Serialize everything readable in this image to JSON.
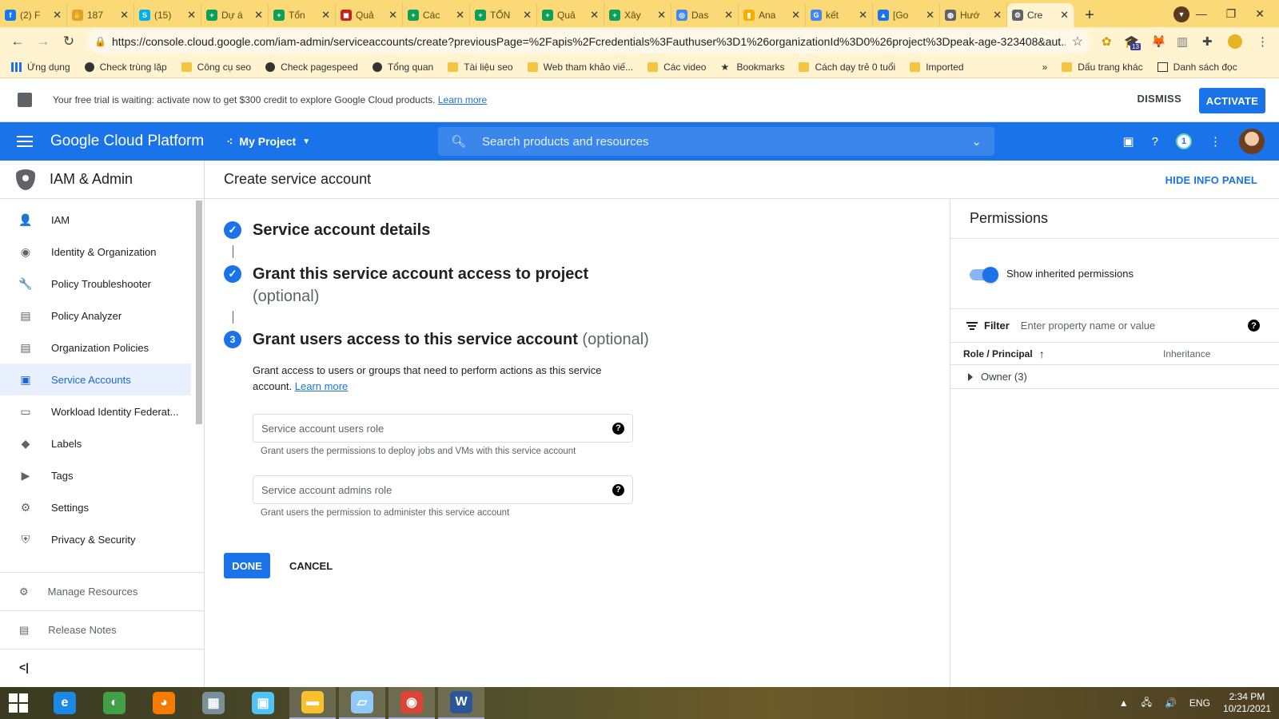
{
  "colors": {
    "accent": "#1a73e8",
    "browser_frame": "#fbd976",
    "active_nav_bg": "#e8f0fe"
  },
  "browser": {
    "tabs": [
      {
        "title": "(2) F",
        "icon": "facebook-icon",
        "color": "#1877f2",
        "glyph": "f"
      },
      {
        "title": "187",
        "icon": "hand-icon",
        "color": "#e0a030",
        "glyph": "✋"
      },
      {
        "title": "(15)",
        "icon": "skype-icon",
        "color": "#00aff0",
        "glyph": "S"
      },
      {
        "title": "Dự á",
        "icon": "sheets-icon",
        "color": "#0f9d58",
        "glyph": "+"
      },
      {
        "title": "Tổn",
        "icon": "sheets-icon",
        "color": "#0f9d58",
        "glyph": "+"
      },
      {
        "title": "Quả",
        "icon": "slides-icon",
        "color": "#c5221f",
        "glyph": "◼"
      },
      {
        "title": "Các",
        "icon": "sheets-icon",
        "color": "#0f9d58",
        "glyph": "+"
      },
      {
        "title": "TỔN",
        "icon": "sheets-icon",
        "color": "#0f9d58",
        "glyph": "+"
      },
      {
        "title": "Quả",
        "icon": "sheets-icon",
        "color": "#0f9d58",
        "glyph": "+"
      },
      {
        "title": "Xây",
        "icon": "sheets-icon",
        "color": "#0f9d58",
        "glyph": "+"
      },
      {
        "title": "Das",
        "icon": "datastudio-icon",
        "color": "#4285f4",
        "glyph": "◎"
      },
      {
        "title": "Ana",
        "icon": "analytics-icon",
        "color": "#f9ab00",
        "glyph": "▮"
      },
      {
        "title": "kết",
        "icon": "google-icon",
        "color": "#4285f4",
        "glyph": "G"
      },
      {
        "title": "[Go",
        "icon": "drive-icon",
        "color": "#1a73e8",
        "glyph": "▲"
      },
      {
        "title": "Hướ",
        "icon": "globe-icon",
        "color": "#5f6368",
        "glyph": "◍"
      },
      {
        "title": "Cre",
        "icon": "gcp-settings-icon",
        "color": "#5f6368",
        "glyph": "⚙"
      }
    ],
    "url": "https://console.cloud.google.com/iam-admin/serviceaccounts/create?previousPage=%2Fapis%2Fcredentials%3Fauthuser%3D1%26organizationId%3D0%26project%3Dpeak-age-323408&aut...",
    "bookmarks": [
      {
        "label": "Ứng dụng",
        "icon": "apps-grid-icon"
      },
      {
        "label": "Check trùng lặp",
        "icon": "globe-icon"
      },
      {
        "label": "Công cụ seo",
        "icon": "folder-icon"
      },
      {
        "label": "Check pagespeed",
        "icon": "globe-icon"
      },
      {
        "label": "Tổng quan",
        "icon": "filter-icon"
      },
      {
        "label": "Tài liệu seo",
        "icon": "folder-icon"
      },
      {
        "label": "Web tham khảo viế...",
        "icon": "folder-icon"
      },
      {
        "label": "Các video",
        "icon": "folder-icon"
      },
      {
        "label": "Bookmarks",
        "icon": "star-icon"
      },
      {
        "label": "Cách dạy trẻ 0 tuổi",
        "icon": "folder-icon"
      },
      {
        "label": "Imported",
        "icon": "folder-icon"
      }
    ],
    "bookmarks_more": "»",
    "other_bookmarks": "Dấu trang khác",
    "reading_list": "Danh sách đọc",
    "extension_badge": "13"
  },
  "trial": {
    "message": "Your free trial is waiting: activate now to get $300 credit to explore Google Cloud products.",
    "learn_more": "Learn more",
    "dismiss": "DISMISS",
    "activate": "ACTIVATE"
  },
  "header": {
    "brand": "Google Cloud Platform",
    "project": "My Project",
    "search_placeholder": "Search products and resources",
    "notification_count": "1"
  },
  "sidebar": {
    "title": "IAM & Admin",
    "items": [
      {
        "label": "IAM",
        "icon": "add-person-icon",
        "glyph": "👤"
      },
      {
        "label": "Identity & Organization",
        "icon": "account-circle-icon",
        "glyph": "◉"
      },
      {
        "label": "Policy Troubleshooter",
        "icon": "wrench-icon",
        "glyph": "🔧"
      },
      {
        "label": "Policy Analyzer",
        "icon": "document-search-icon",
        "glyph": "▤"
      },
      {
        "label": "Organization Policies",
        "icon": "list-document-icon",
        "glyph": "▤"
      },
      {
        "label": "Service Accounts",
        "icon": "service-account-icon",
        "glyph": "▣"
      },
      {
        "label": "Workload Identity Federat...",
        "icon": "id-card-icon",
        "glyph": "▭"
      },
      {
        "label": "Labels",
        "icon": "label-icon",
        "glyph": "◆"
      },
      {
        "label": "Tags",
        "icon": "tag-icon",
        "glyph": "▶"
      },
      {
        "label": "Settings",
        "icon": "gear-icon",
        "glyph": "⚙"
      },
      {
        "label": "Privacy & Security",
        "icon": "shield-icon",
        "glyph": "⛨"
      }
    ],
    "bottom": [
      {
        "label": "Manage Resources",
        "icon": "manage-resources-icon",
        "glyph": "⚙"
      },
      {
        "label": "Release Notes",
        "icon": "release-notes-icon",
        "glyph": "▤"
      }
    ],
    "collapse": "<|"
  },
  "main": {
    "title": "Create service account",
    "hide_info_panel": "HIDE INFO PANEL",
    "step1": {
      "title": "Service account details"
    },
    "step2": {
      "title": "Grant this service account access to project",
      "optional": "(optional)"
    },
    "step3": {
      "number": "3",
      "title": "Grant users access to this service account",
      "optional": "(optional)",
      "description": "Grant access to users or groups that need to perform actions as this service account.",
      "learn_more": "Learn more"
    },
    "users_role": {
      "placeholder": "Service account users role",
      "hint": "Grant users the permissions to deploy jobs and VMs with this service account"
    },
    "admins_role": {
      "placeholder": "Service account admins role",
      "hint": "Grant users the permission to administer this service account"
    },
    "done": "DONE",
    "cancel": "CANCEL"
  },
  "panel": {
    "title": "Permissions",
    "toggle_label": "Show inherited permissions",
    "toggle_on": true,
    "filter_label": "Filter",
    "filter_placeholder": "Enter property name or value",
    "col_role": "Role / Principal",
    "col_inheritance": "Inheritance",
    "rows": [
      {
        "label": "Owner (3)"
      }
    ]
  },
  "taskbar": {
    "apps": [
      {
        "icon": "ie-icon",
        "color": "#1e88e5",
        "glyph": "e",
        "open": false
      },
      {
        "icon": "coccoc-icon",
        "color": "#43a047",
        "glyph": "◐",
        "open": false
      },
      {
        "icon": "firefox-icon",
        "color": "#f57c00",
        "glyph": "◕",
        "open": false
      },
      {
        "icon": "calculator-icon",
        "color": "#78909c",
        "glyph": "▦",
        "open": false
      },
      {
        "icon": "control-panel-icon",
        "color": "#4fc3f7",
        "glyph": "▣",
        "open": false
      },
      {
        "icon": "file-explorer-icon",
        "color": "#fbc02d",
        "glyph": "▬",
        "open": true
      },
      {
        "icon": "notepad-icon",
        "color": "#90caf9",
        "glyph": "▱",
        "open": true
      },
      {
        "icon": "chrome-icon",
        "color": "#db4437",
        "glyph": "◉",
        "open": true
      },
      {
        "icon": "word-icon",
        "color": "#2b579a",
        "glyph": "W",
        "open": true
      }
    ],
    "language": "ENG",
    "time": "2:34 PM",
    "date": "10/21/2021"
  }
}
